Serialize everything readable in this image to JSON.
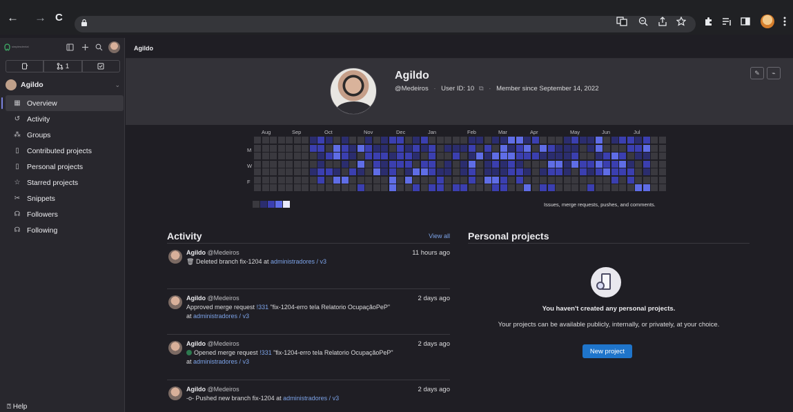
{
  "browser": {
    "back_icon": "←",
    "forward_icon": "→",
    "reload_icon": "C"
  },
  "sidebar": {
    "brand_text": "simplesdental",
    "counts": {
      "merge_requests": "1"
    },
    "user": "Agildo",
    "items": [
      {
        "label": "Overview",
        "icon": "overview-icon"
      },
      {
        "label": "Activity",
        "icon": "history-icon"
      },
      {
        "label": "Groups",
        "icon": "group-icon"
      },
      {
        "label": "Contributed projects",
        "icon": "project-icon"
      },
      {
        "label": "Personal projects",
        "icon": "project-icon"
      },
      {
        "label": "Starred projects",
        "icon": "star-icon"
      },
      {
        "label": "Snippets",
        "icon": "snippet-icon"
      },
      {
        "label": "Followers",
        "icon": "users-icon"
      },
      {
        "label": "Following",
        "icon": "users-icon"
      }
    ],
    "help_label": "Help"
  },
  "breadcrumb": "Agildo",
  "profile": {
    "name": "Agildo",
    "handle": "@Medeiros",
    "user_id_label": "User ID: 10",
    "member_since": "Member since September 14, 2022"
  },
  "graph": {
    "months": [
      "Aug",
      "Sep",
      "Oct",
      "Nov",
      "Dec",
      "Jan",
      "Feb",
      "Mar",
      "Apr",
      "May",
      "Jun",
      "Jul"
    ],
    "days": [
      "M",
      "W",
      "F"
    ],
    "note": "Issues, merge requests, pushes, and comments.",
    "colors": {
      "none": "#3a393f",
      "l1": "#2b2d6e",
      "l2": "#3b3fb0",
      "l3": "#5f6de6",
      "l4": "#e9ebff"
    }
  },
  "activity": {
    "title": "Activity",
    "view_all": "View all",
    "events": [
      {
        "author": "Agildo",
        "handle": "@Medeiros",
        "time": "11 hours ago",
        "prefix": "Deleted branch fix-1204 at ",
        "target": "administradores / v3",
        "mr": "",
        "mr_title": "",
        "at": "",
        "icon": "trash-icon"
      },
      {
        "author": "Agildo",
        "handle": "@Medeiros",
        "time": "2 days ago",
        "prefix": "Approved merge request ",
        "mr": "!331",
        "mr_title": " \"fix-1204-erro tela Relatorio OcupaçãoPeP\"",
        "at": "at ",
        "target": "administradores / v3",
        "icon": ""
      },
      {
        "author": "Agildo",
        "handle": "@Medeiros",
        "time": "2 days ago",
        "prefix": "Opened merge request ",
        "mr": "!331",
        "mr_title": " \"fix-1204-erro tela Relatorio OcupaçãoPeP\"",
        "at": "at ",
        "target": "administradores / v3",
        "icon": "status-open-icon"
      },
      {
        "author": "Agildo",
        "handle": "@Medeiros",
        "time": "2 days ago",
        "prefix": "Pushed new branch fix-1204 at ",
        "target": "administradores / v3",
        "mr": "",
        "mr_title": "",
        "at": "",
        "icon": "commit-icon"
      }
    ]
  },
  "personal_projects": {
    "title": "Personal projects",
    "empty_title": "You haven't created any personal projects.",
    "empty_desc": "Your projects can be available publicly, internally, or privately, at your choice.",
    "new_button": "New project"
  }
}
